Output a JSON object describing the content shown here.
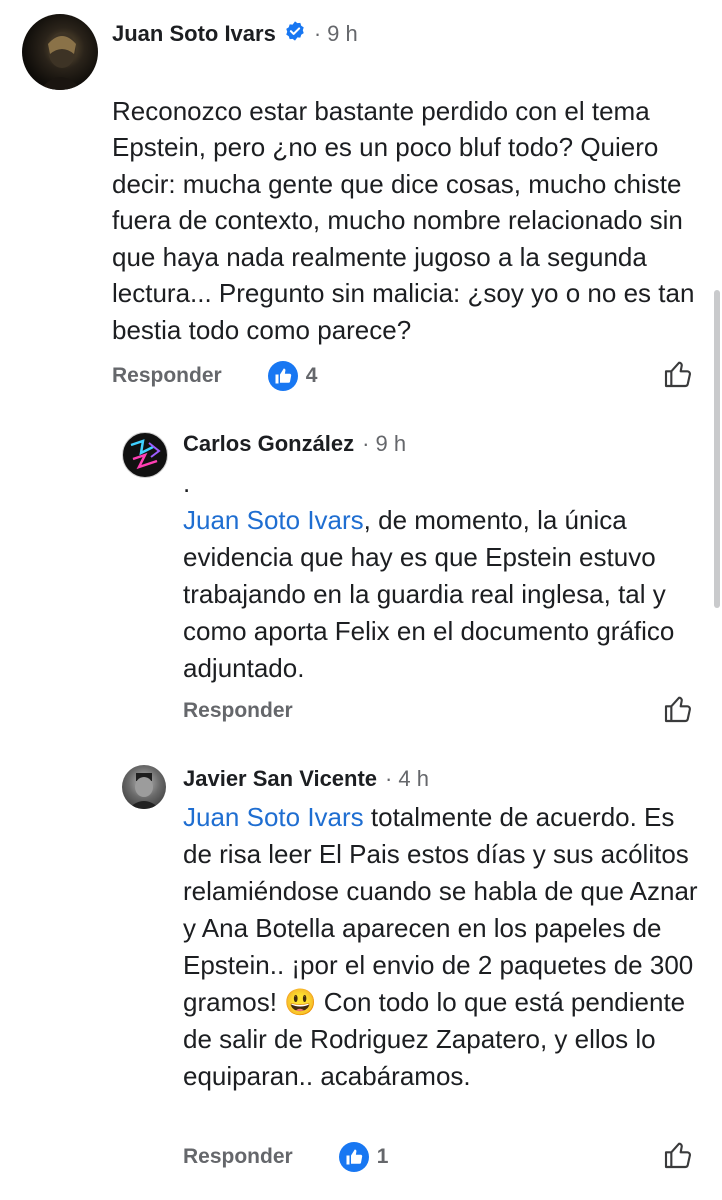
{
  "comments": [
    {
      "author": "Juan Soto Ivars",
      "verified": true,
      "separator": "·",
      "time": "9 h",
      "mention": "",
      "text": "Reconozco estar bastante perdido con el tema Epstein, pero ¿no es un poco bluf todo? Quiero decir: mucha gente que dice cosas, mucho chiste fuera de contexto, mucho nombre relacionado sin que haya nada realmente jugoso a la segunda lectura... Pregunto sin malicia: ¿soy yo o no es tan bestia todo como parece?",
      "reply_label": "Responder",
      "reaction_count": "4"
    },
    {
      "author": "Carlos González",
      "verified": false,
      "separator": "·",
      "time": "9 h",
      "prefix": ".",
      "mention": "Juan Soto Ivars",
      "text": ", de momento, la única evidencia que hay es que Epstein estuvo trabajando en la guardia real inglesa, tal y como aporta Felix en el documento gráfico adjuntado.",
      "reply_label": "Responder",
      "reaction_count": ""
    },
    {
      "author": "Javier San Vicente",
      "verified": false,
      "separator": "·",
      "time": "4 h",
      "mention": "Juan Soto Ivars",
      "text": " totalmente de acuerdo. Es de risa leer El Pais estos días y sus acólitos relamiéndose cuando se habla de que Aznar y Ana Botella aparecen en los papeles de Epstein.. ¡por el envio de 2 paquetes de 300 gramos! 😃 Con todo lo que está pendiente de salir de Rodriguez Zapatero, y ellos lo equiparan.. acabáramos.",
      "reply_label": "Responder",
      "reaction_count": "1"
    }
  ],
  "colors": {
    "mention": "#1f6ed1",
    "reaction": "#1877f2",
    "secondary_text": "#65676b"
  },
  "icons": {
    "verified": "verified-badge-icon",
    "reaction": "like-reaction-icon",
    "like_button": "thumbs-up-outline-icon"
  }
}
